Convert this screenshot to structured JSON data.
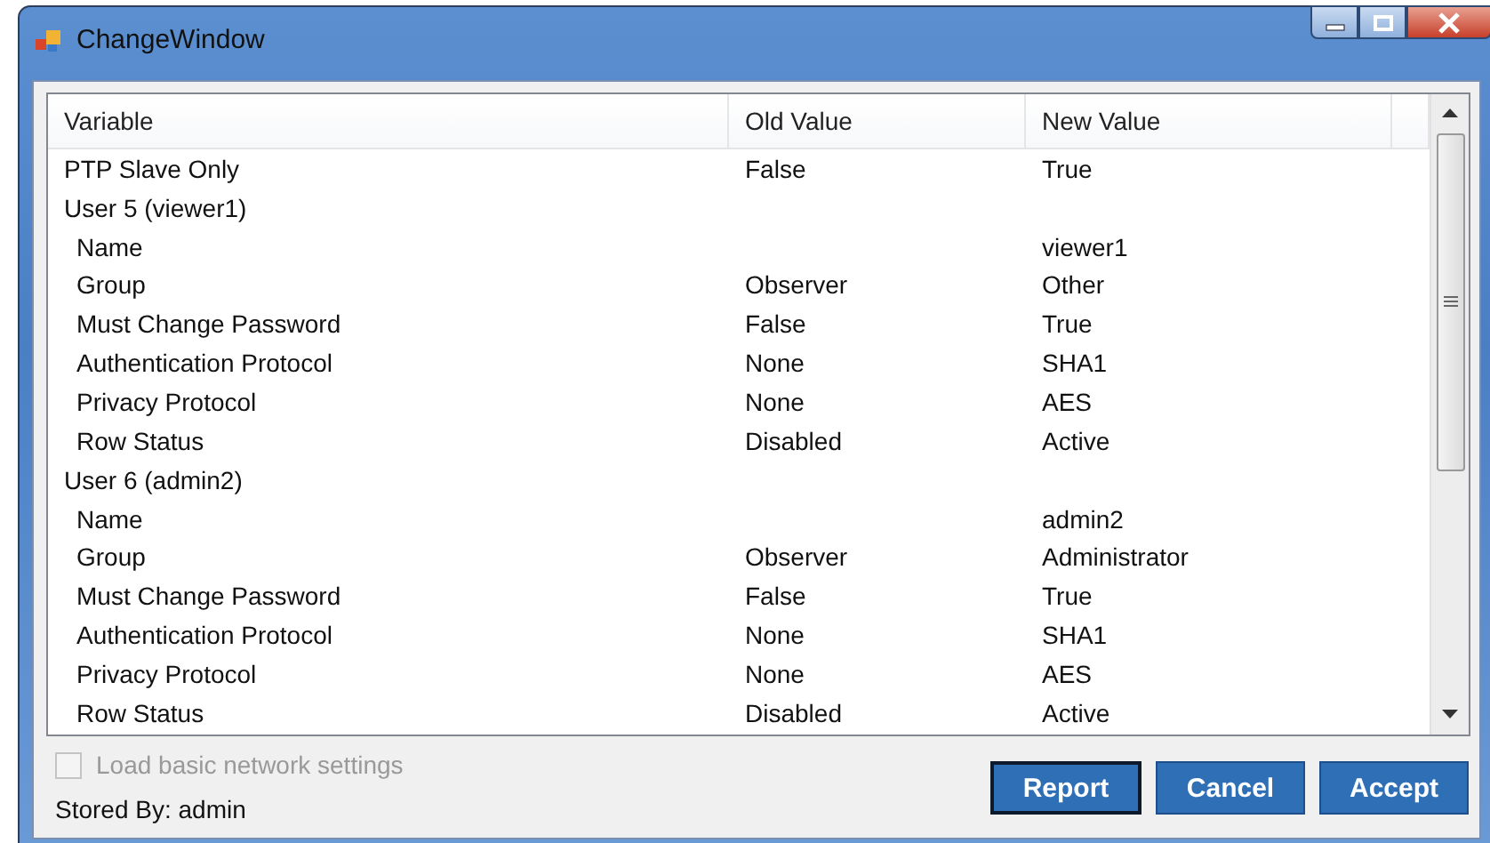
{
  "window": {
    "title": "ChangeWindow"
  },
  "table": {
    "columns": [
      "Variable",
      "Old Value",
      "New Value"
    ],
    "rows": [
      {
        "variable": "PTP Slave Only",
        "old": "False",
        "new": "True"
      },
      {
        "variable": "User 5 (viewer1)",
        "children": [
          {
            "variable": "Name",
            "new": "viewer1"
          },
          {
            "variable": "Group",
            "old": "Observer",
            "new": "Other"
          },
          {
            "variable": "Must Change Password",
            "old": "False",
            "new": "True"
          },
          {
            "variable": "Authentication Protocol",
            "old": "None",
            "new": "SHA1"
          },
          {
            "variable": "Privacy Protocol",
            "old": "None",
            "new": "AES"
          },
          {
            "variable": "Row Status",
            "old": "Disabled",
            "new": "Active"
          }
        ]
      },
      {
        "variable": "User 6 (admin2)",
        "children": [
          {
            "variable": "Name",
            "new": "admin2"
          },
          {
            "variable": "Group",
            "old": "Observer",
            "new": "Administrator"
          },
          {
            "variable": "Must Change Password",
            "old": "False",
            "new": "True"
          },
          {
            "variable": "Authentication Protocol",
            "old": "None",
            "new": "SHA1"
          },
          {
            "variable": "Privacy Protocol",
            "old": "None",
            "new": "AES"
          },
          {
            "variable": "Row Status",
            "old": "Disabled",
            "new": "Active"
          }
        ]
      }
    ]
  },
  "load_basic": {
    "label": "Load basic network settings",
    "checked": false,
    "disabled": true
  },
  "stored_by": "Stored By: admin",
  "buttons": [
    {
      "label": "Report",
      "selected": true
    },
    {
      "label": "Cancel",
      "selected": false
    },
    {
      "label": "Accept",
      "selected": false
    }
  ]
}
